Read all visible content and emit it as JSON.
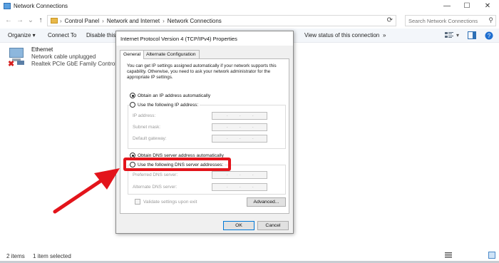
{
  "window": {
    "title": "Network Connections",
    "controls": {
      "minimize": "—",
      "maximize": "☐",
      "close": "✕"
    }
  },
  "address": {
    "back": "←",
    "forward": "→",
    "recent": "⌄",
    "up": "↑",
    "crumbs": [
      "Control Panel",
      "Network and Internet",
      "Network Connections"
    ],
    "separator": "›",
    "refresh": "⟳",
    "search_placeholder": "Search Network Connections"
  },
  "toolbar": {
    "organize": "Organize ▾",
    "connect_to": "Connect To",
    "disable": "Disable this",
    "view_status": "View status of this connection",
    "more": "»"
  },
  "adapter": {
    "name": "Ethernet",
    "status": "Network cable unplugged",
    "device": "Realtek PCIe GbE Family Controller"
  },
  "status_bar": {
    "items": "2 items",
    "selected": "1 item selected"
  },
  "dialog": {
    "title": "Internet Protocol Version 4 (TCP/IPv4) Properties",
    "tabs": [
      "General",
      "Alternate Configuration"
    ],
    "info": "You can get IP settings assigned automatically if your network supports this capability. Otherwise, you need to ask your network administrator for the appropriate IP settings.",
    "ip_auto": "Obtain an IP address automatically",
    "ip_manual": "Use the following IP address:",
    "ip_fields": [
      "IP address:",
      "Subnet mask:",
      "Default gateway:"
    ],
    "dns_auto": "Obtain DNS server address automatically",
    "dns_manual": "Use the following DNS server addresses:",
    "dns_fields": [
      "Preferred DNS server:",
      "Alternate DNS server:"
    ],
    "validate": "Validate settings upon exit",
    "advanced": "Advanced...",
    "ok": "OK",
    "cancel": "Cancel",
    "ip_dot": "."
  },
  "colors": {
    "annotation_red": "#e3141b",
    "command_bar_bg": "#f3f6fa"
  }
}
